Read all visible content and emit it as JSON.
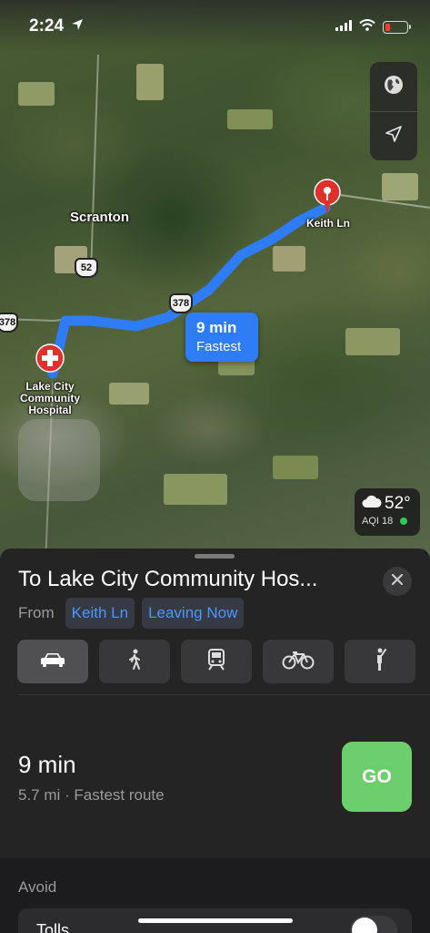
{
  "status_bar": {
    "time": "2:24"
  },
  "map": {
    "places": {
      "scranton": "Scranton",
      "destination_pin": "Keith Ln",
      "origin_hospital": "Lake City\nCommunity\nHospital"
    },
    "highways": {
      "hwy_52": "52",
      "hwy_378_mid": "378",
      "hwy_378_left": "378"
    },
    "route_bubble": {
      "time": "9 min",
      "label": "Fastest"
    },
    "controls": {
      "globe": "globe-icon",
      "locate": "location-arrow-icon"
    },
    "weather": {
      "temp": "52°",
      "aqi": "AQI 18"
    },
    "colors": {
      "route": "#2e7cf6",
      "pin": "#e0302b"
    }
  },
  "sheet": {
    "title": "To Lake City Community Hos...",
    "from_label": "From",
    "from_chip": "Keith Ln",
    "time_chip": "Leaving Now",
    "modes": [
      "car-icon",
      "walk-icon",
      "transit-icon",
      "bike-icon",
      "rideshare-icon"
    ],
    "route": {
      "time": "9 min",
      "subtitle": "5.7 mi · Fastest route"
    },
    "go_label": "GO",
    "avoid_heading": "Avoid",
    "avoid_items": [
      {
        "label": "Tolls",
        "on": false
      }
    ],
    "colors": {
      "go": "#6ccf6c",
      "accent": "#4c97ff"
    }
  }
}
